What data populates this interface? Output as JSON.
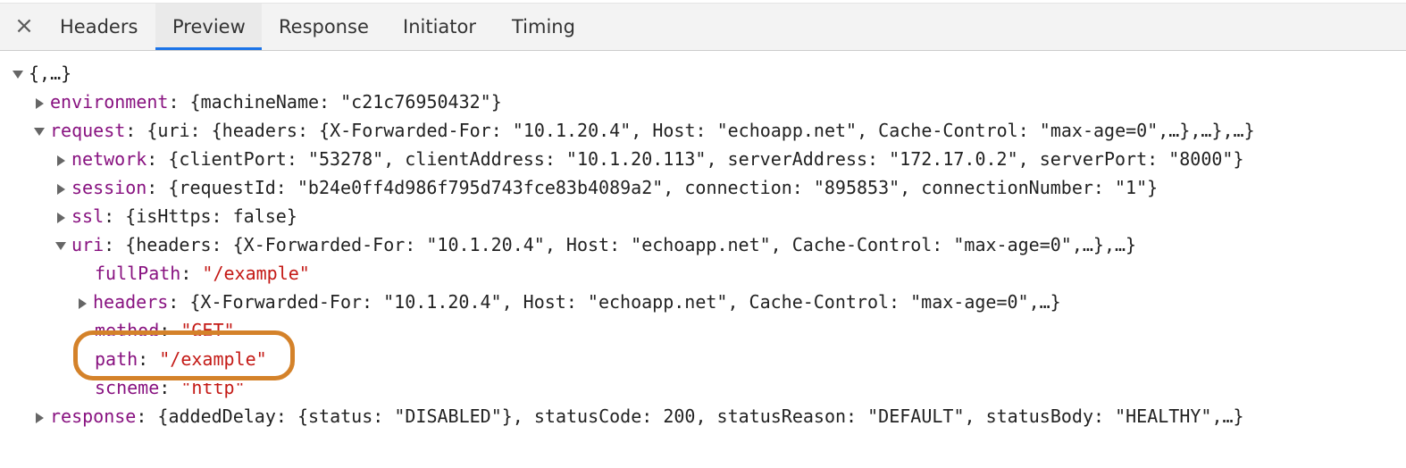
{
  "tabs": {
    "close_symbol": "×",
    "headers": "Headers",
    "preview": "Preview",
    "response": "Response",
    "initiator": "Initiator",
    "timing": "Timing",
    "active": "Preview",
    "accent_color": "#1a73e8"
  },
  "tree": {
    "root": "{,…}",
    "environment": {
      "key": "environment",
      "summary": "{machineName: \"c21c76950432\"}"
    },
    "request": {
      "key": "request",
      "summary": "{uri: {headers: {X-Forwarded-For: \"10.1.20.4\", Host: \"echoapp.net\", Cache-Control: \"max-age=0\",…},…},…}",
      "network": {
        "key": "network",
        "summary": "{clientPort: \"53278\", clientAddress: \"10.1.20.113\", serverAddress: \"172.17.0.2\", serverPort: \"8000\"}"
      },
      "session": {
        "key": "session",
        "summary": "{requestId: \"b24e0ff4d986f795d743fce83b4089a2\", connection: \"895853\", connectionNumber: \"1\"}"
      },
      "ssl": {
        "key": "ssl",
        "summary": "{isHttps: false}"
      },
      "uri": {
        "key": "uri",
        "summary": "{headers: {X-Forwarded-For: \"10.1.20.4\", Host: \"echoapp.net\", Cache-Control: \"max-age=0\",…},…}",
        "fullPath": {
          "key": "fullPath",
          "value": "\"/example\""
        },
        "headers": {
          "key": "headers",
          "summary": "{X-Forwarded-For: \"10.1.20.4\", Host: \"echoapp.net\", Cache-Control: \"max-age=0\",…}"
        },
        "method": {
          "key": "method",
          "value": "\"GET\""
        },
        "path": {
          "key": "path",
          "value": "\"/example\""
        },
        "scheme": {
          "key": "scheme",
          "value": "\"http\""
        }
      }
    },
    "response": {
      "key": "response",
      "summary": "{addedDelay: {status: \"DISABLED\"}, statusCode: 200, statusReason: \"DEFAULT\", statusBody: \"HEALTHY\",…}"
    },
    "colors": {
      "key": "#881280",
      "string": "#c41a16",
      "highlight": "#d4822a"
    }
  }
}
